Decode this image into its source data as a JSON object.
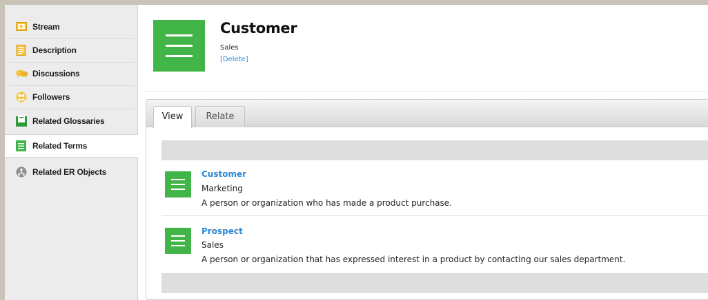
{
  "sidebar": {
    "items": [
      {
        "label": "Stream",
        "icon": "stream-icon"
      },
      {
        "label": "Description",
        "icon": "description-icon"
      },
      {
        "label": "Discussions",
        "icon": "discussions-icon"
      },
      {
        "label": "Followers",
        "icon": "followers-icon"
      },
      {
        "label": "Related Glossaries",
        "icon": "glossaries-icon"
      },
      {
        "label": "Related Terms",
        "icon": "terms-icon",
        "active": true
      },
      {
        "label": "Related ER Objects",
        "icon": "er-objects-icon"
      }
    ]
  },
  "header": {
    "title": "Customer",
    "subtitle": "Sales",
    "delete_label": "[Delete]"
  },
  "tabs": [
    {
      "label": "View",
      "active": true
    },
    {
      "label": "Relate",
      "active": false
    }
  ],
  "terms": [
    {
      "name": "Customer",
      "category": "Marketing",
      "description": "A person or organization who has made a product purchase."
    },
    {
      "name": "Prospect",
      "category": "Sales",
      "description": "A person or organization that has expressed interest in a product by contacting our sales department."
    }
  ],
  "colors": {
    "accent_green": "#42b549",
    "link_blue": "#2e89d6"
  }
}
